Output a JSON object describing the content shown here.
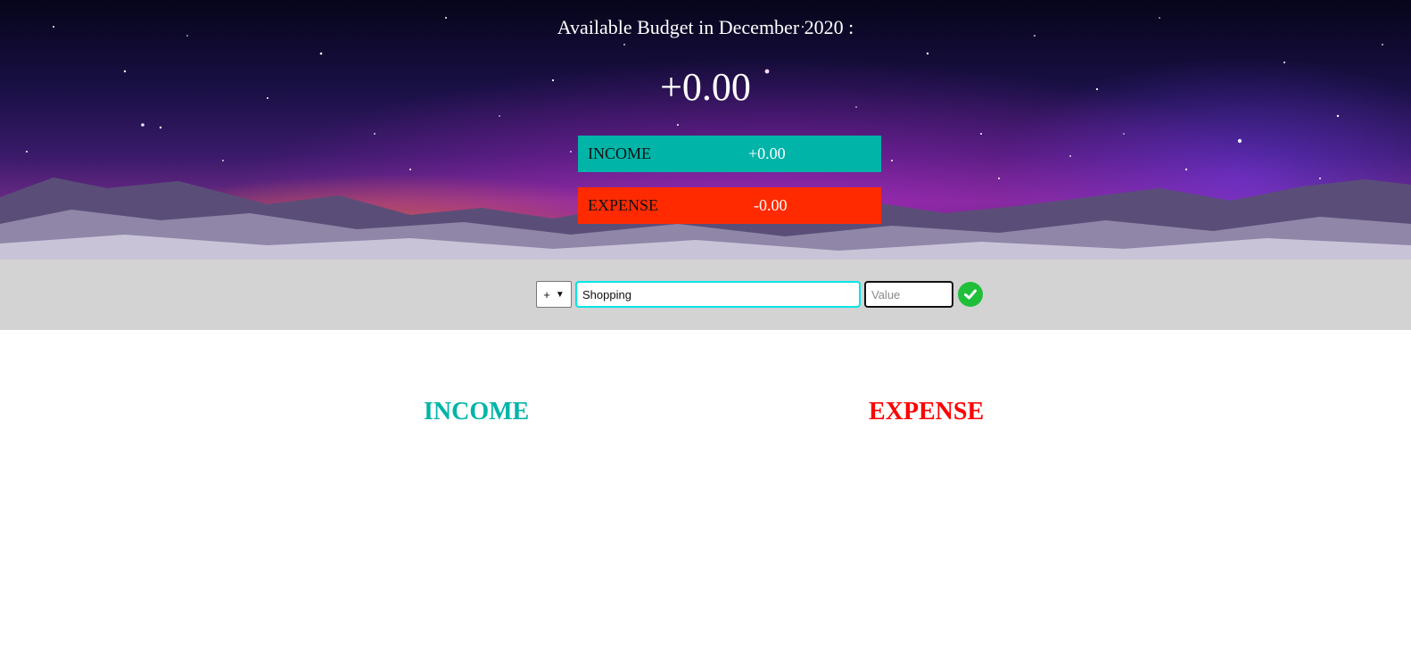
{
  "header": {
    "title": "Available Budget in December 2020 :",
    "budget": "+0.00",
    "income": {
      "label": "INCOME",
      "value": "+0.00"
    },
    "expense": {
      "label": "EXPENSE",
      "value": "-0.00"
    }
  },
  "add_form": {
    "type_selected": "+",
    "description_value": "Shopping",
    "value_placeholder": "Value",
    "submit_icon": "check-circle-icon"
  },
  "lists": {
    "income_title": "INCOME",
    "expense_title": "EXPENSE"
  },
  "colors": {
    "income": "#00b4a8",
    "expense": "#ff2a00",
    "submit": "#1fbf3a",
    "add_bar": "#d3d3d3"
  }
}
